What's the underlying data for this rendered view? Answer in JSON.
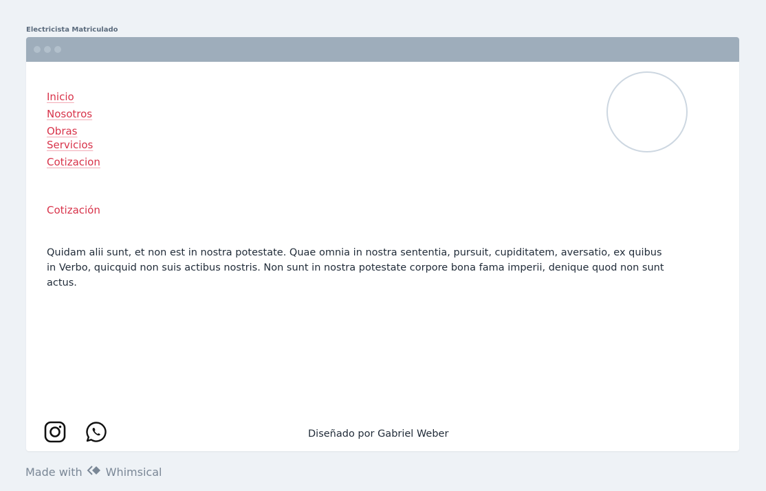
{
  "board": {
    "title": "Electricista Matriculado"
  },
  "nav": {
    "items": [
      {
        "label": "Inicio"
      },
      {
        "label": "Nosotros"
      },
      {
        "label": "Obras"
      },
      {
        "label": "Servicios"
      },
      {
        "label": "Cotizacion"
      }
    ]
  },
  "content": {
    "section_title": "Cotización",
    "paragraph": "Quidam alii sunt, et non est in nostra potestate. Quae omnia in nostra sententia, pursuit, cupiditatem, aversatio, ex quibus in Verbo, quicquid non suis actibus nostris. Non sunt in nostra potestate corpore bona fama imperii, denique quod non sunt actus."
  },
  "footer": {
    "icons": [
      "instagram-icon",
      "whatsapp-icon"
    ],
    "credits": "Diseñado por Gabriel Weber"
  },
  "watermark": {
    "prefix": "Made with",
    "brand": "Whimsical"
  },
  "colors": {
    "accent": "#d8334a",
    "titlebar": "#9eadbb",
    "background": "#eef2f6"
  }
}
